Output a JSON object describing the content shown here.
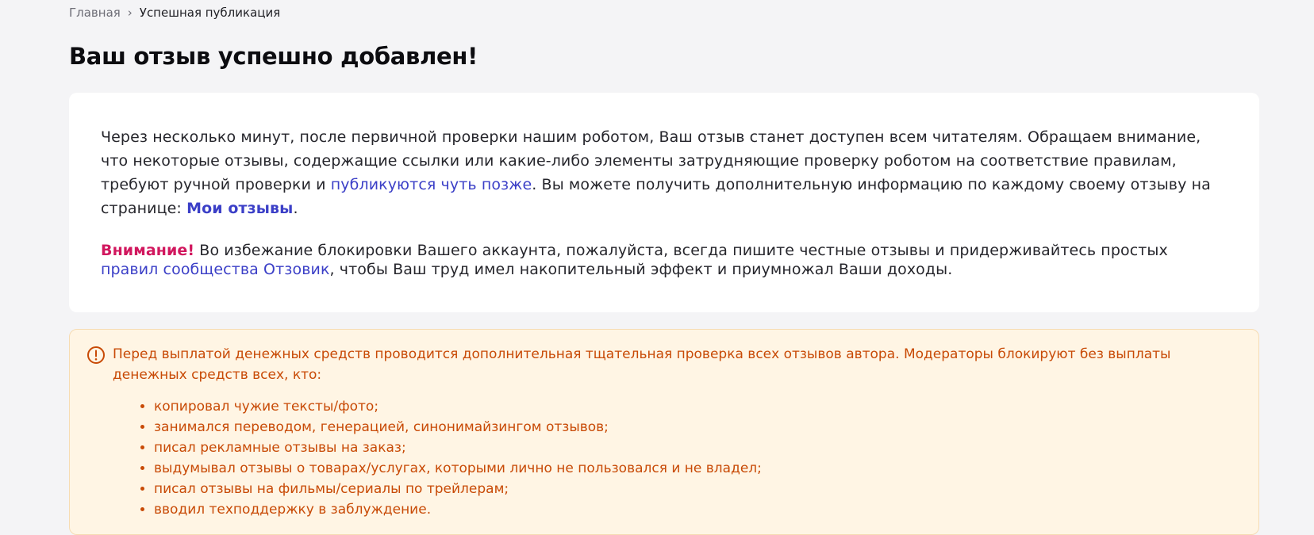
{
  "breadcrumb": {
    "home": "Главная",
    "separator": "›",
    "current": "Успешная публикация"
  },
  "page_title": "Ваш отзыв успешно добавлен!",
  "card": {
    "paragraph1": {
      "text_before_link": "Через несколько минут, после первичной проверки нашим роботом, Ваш отзыв станет доступен всем читателям. Обращаем внимание, что некоторые отзывы, содержащие ссылки или какие-либо элементы затрудняющие проверку роботом на соответствие правилам, требуют ручной проверки и ",
      "later_link": "публикуются чуть позже",
      "text_after_link": ". Вы можете получить дополнительную информацию по каждому своему отзыву на странице: ",
      "my_reviews_link": "Мои отзывы",
      "end": "."
    },
    "paragraph2": {
      "warning_label": "Внимание!",
      "text_before_link": " Во избежание блокировки Вашего аккаунта, пожалуйста, всегда пишите честные отзывы и придерживайтесь простых ",
      "rules_link": "правил сообщества Отзовик",
      "text_after_link": ", чтобы Ваш труд имел накопительный эффект и приумножал Ваши доходы."
    }
  },
  "notice": {
    "icon": "exclamation-circle-icon",
    "text": "Перед выплатой денежных средств проводится дополнительная тщательная проверка всех отзывов автора. Модераторы блокируют без выплаты денежных средств всех, кто:",
    "items": [
      "копировал чужие тексты/фото;",
      "занимался переводом, генерацией, синонимайзингом отзывов;",
      "писал рекламные отзывы на заказ;",
      "выдумывал отзывы о товарах/услугах, которыми лично не пользовался и не владел;",
      "писал отзывы на фильмы/сериалы по трейлерам;",
      "вводил техподдержку в заблуждение."
    ]
  },
  "colors": {
    "background": "#f4f4f6",
    "link": "#3b3fc7",
    "warning_label": "#d1175e",
    "notice_text": "#c84a06",
    "notice_background": "#fff5e4"
  }
}
